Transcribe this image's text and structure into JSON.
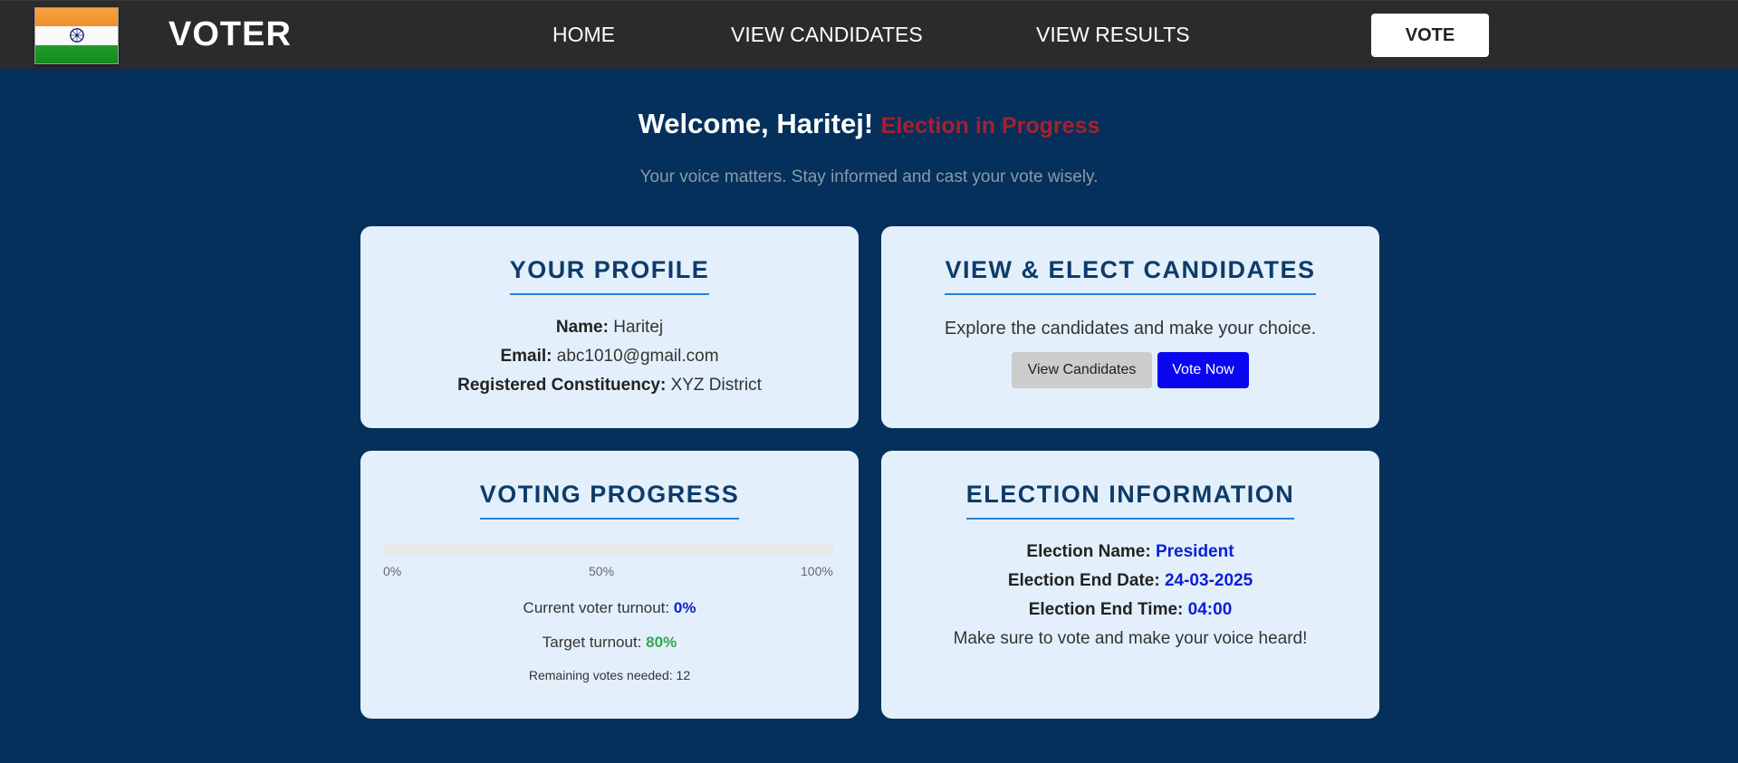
{
  "nav": {
    "brand": "VOTER",
    "links": [
      "HOME",
      "VIEW CANDIDATES",
      "VIEW RESULTS"
    ],
    "vote_button": "VOTE",
    "logo_icon": "india-flag-icon"
  },
  "welcome": {
    "greeting": "Welcome, Haritej!",
    "status": "Election in Progress",
    "tagline": "Your voice matters. Stay informed and cast your vote wisely."
  },
  "profile": {
    "title": "YOUR PROFILE",
    "name_label": "Name:",
    "name_value": "Haritej",
    "email_label": "Email:",
    "email_value": "abc1010@gmail.com",
    "constituency_label": "Registered Constituency:",
    "constituency_value": "XYZ District"
  },
  "candidates": {
    "title": "VIEW & ELECT CANDIDATES",
    "text": "Explore the candidates and make your choice.",
    "view_button": "View Candidates",
    "vote_button": "Vote Now"
  },
  "progress": {
    "title": "VOTING PROGRESS",
    "fill_percent": 0,
    "scale_labels": [
      "0%",
      "50%",
      "100%"
    ],
    "turnout_label": "Current voter turnout:",
    "turnout_value": "0%",
    "target_label": "Target turnout:",
    "target_value": "80%",
    "remaining_text": "Remaining votes needed: 12"
  },
  "election": {
    "title": "ELECTION INFORMATION",
    "name_label": "Election Name:",
    "name_value": "President",
    "end_date_label": "Election End Date:",
    "end_date_value": "24-03-2025",
    "end_time_label": "Election End Time:",
    "end_time_value": "04:00",
    "note": "Make sure to vote and make your voice heard!"
  },
  "colors": {
    "background": "#04305b",
    "navbar": "#2b2b2b",
    "card": "#e3f0fb",
    "title": "#0d3b6a",
    "status_red": "#a8202d",
    "accent_blue": "#0a1fd6",
    "accent_green": "#2fa84f"
  }
}
